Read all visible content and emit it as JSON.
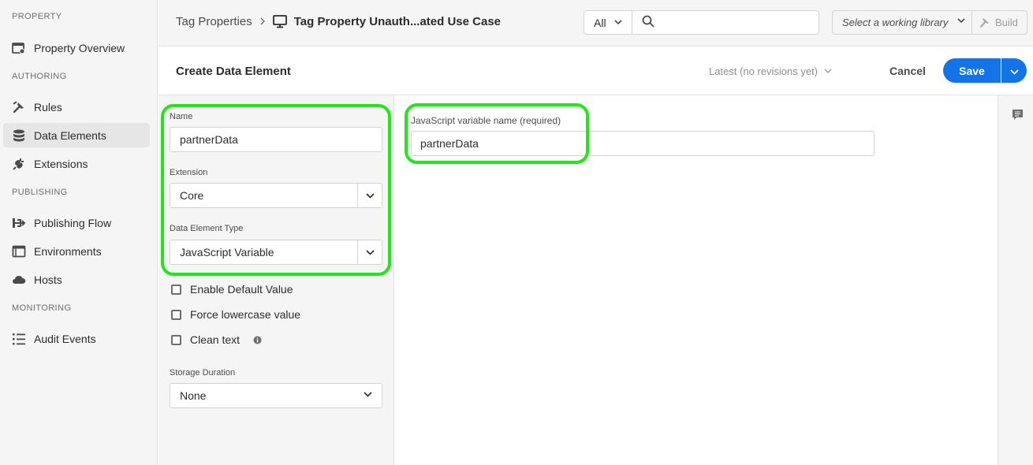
{
  "sidebar": {
    "sections": {
      "property": "PROPERTY",
      "authoring": "AUTHORING",
      "publishing": "PUBLISHING",
      "monitoring": "MONITORING"
    },
    "items": [
      {
        "label": "Property Overview",
        "icon": "property-overview-icon"
      },
      {
        "label": "Rules",
        "icon": "rules-icon"
      },
      {
        "label": "Data Elements",
        "icon": "database-icon",
        "active": true
      },
      {
        "label": "Extensions",
        "icon": "plug-icon"
      },
      {
        "label": "Publishing Flow",
        "icon": "publishing-flow-icon"
      },
      {
        "label": "Environments",
        "icon": "environments-icon"
      },
      {
        "label": "Hosts",
        "icon": "cloud-icon"
      },
      {
        "label": "Audit Events",
        "icon": "list-icon"
      }
    ]
  },
  "topbar": {
    "breadcrumb_root": "Tag Properties",
    "breadcrumb_current": "Tag Property Unauth...ated Use Case",
    "search_scope": "All",
    "search_placeholder": "",
    "library_placeholder": "Select a working library",
    "build_label": "Build"
  },
  "header": {
    "title": "Create Data Element",
    "revision": "Latest (no revisions yet)",
    "cancel_label": "Cancel",
    "save_label": "Save"
  },
  "form": {
    "name_label": "Name",
    "name_value": "partnerData",
    "extension_label": "Extension",
    "extension_value": "Core",
    "type_label": "Data Element Type",
    "type_value": "JavaScript Variable",
    "checkboxes": [
      {
        "label": "Enable Default Value",
        "checked": false
      },
      {
        "label": "Force lowercase value",
        "checked": false
      },
      {
        "label": "Clean text",
        "checked": false
      }
    ],
    "storage_label": "Storage Duration",
    "storage_value": "None"
  },
  "main": {
    "js_var_label": "JavaScript variable name (required)",
    "js_var_value": "partnerData"
  },
  "colors": {
    "accent": "#1473e6",
    "highlight": "#22e61a",
    "sidebar_bg": "#f5f5f5"
  }
}
